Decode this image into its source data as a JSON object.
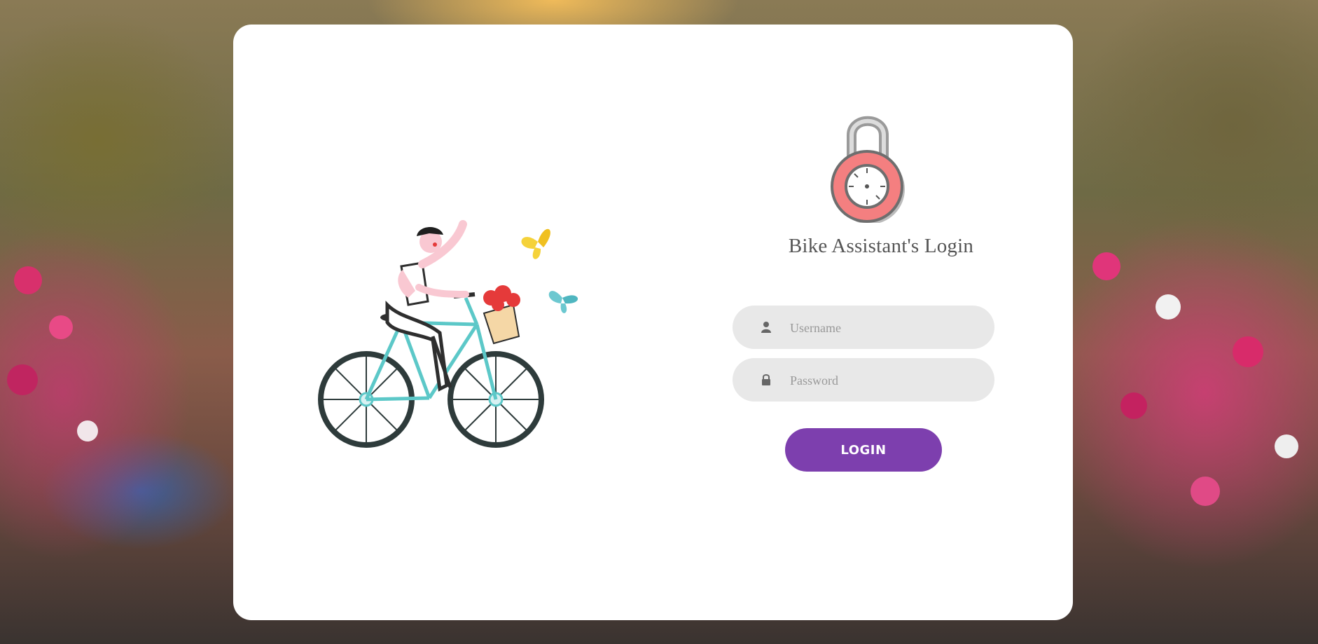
{
  "login": {
    "title": "Bike Assistant's Login",
    "username_placeholder": "Username",
    "password_placeholder": "Password",
    "button_label": "LOGIN"
  },
  "icons": {
    "illustration": "woman-riding-bicycle-illustration",
    "lock": "padlock-icon",
    "user": "user-icon",
    "password": "lock-icon"
  },
  "colors": {
    "accent": "#7d3fae",
    "input_bg": "#e8e8e8",
    "card_bg": "#ffffff",
    "lock_body": "#f47f80"
  }
}
